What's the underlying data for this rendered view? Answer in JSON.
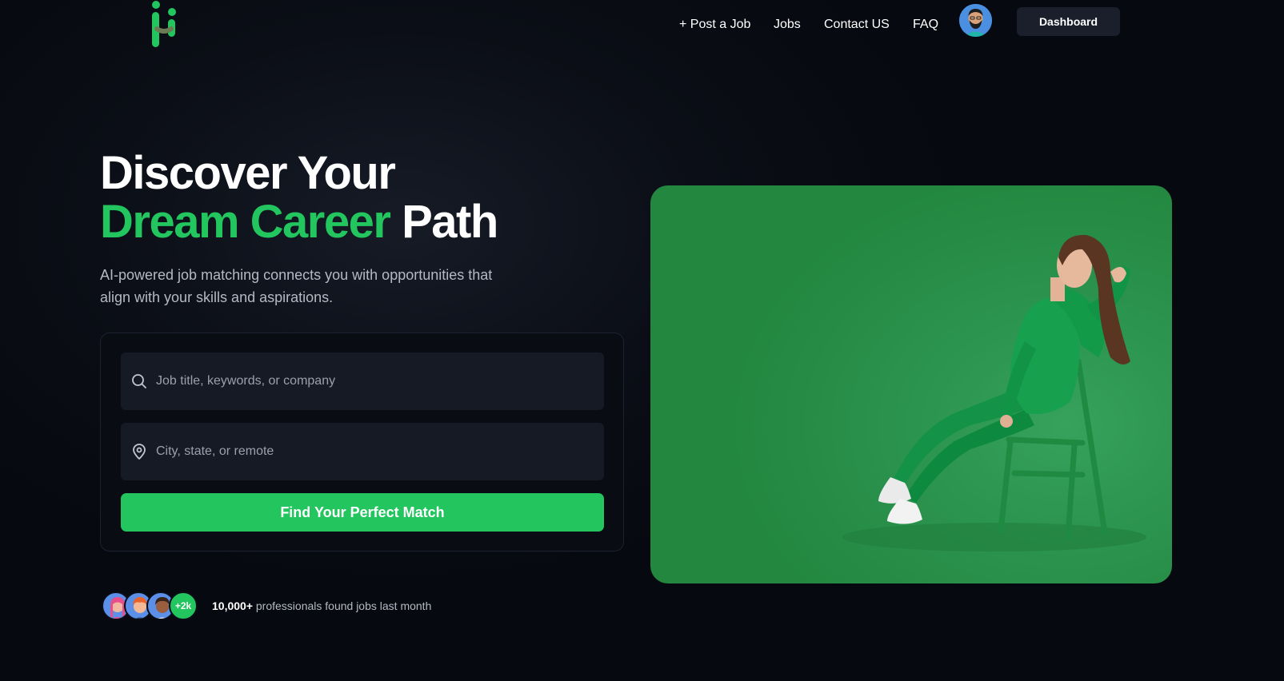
{
  "nav": {
    "links": [
      "+ Post a Job",
      "Jobs",
      "Contact US",
      "FAQ"
    ],
    "dashboard_label": "Dashboard"
  },
  "hero": {
    "title_line1": "Discover Your",
    "title_green": "Dream Career",
    "title_tail": " Path",
    "subtitle": "AI-powered job matching connects you with opportunities that align with your skills and aspirations."
  },
  "search": {
    "job_placeholder": "Job title, keywords, or company",
    "location_placeholder": "City, state, or remote",
    "submit_label": "Find Your Perfect Match"
  },
  "proof": {
    "badge": "+2k",
    "count": "10,000+",
    "text": " professionals found jobs last month"
  },
  "colors": {
    "accent": "#22c55e",
    "background": "#0b0e16",
    "card": "#151a25"
  },
  "icons": [
    "logo",
    "user-avatar",
    "search-icon",
    "map-pin-icon"
  ]
}
